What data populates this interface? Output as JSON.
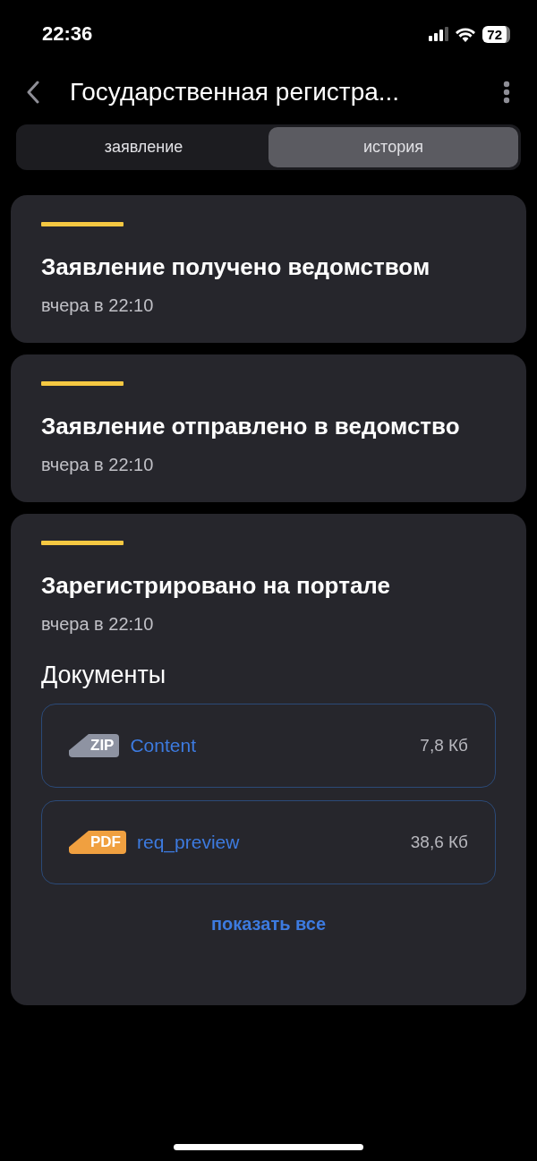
{
  "status_bar": {
    "time": "22:36",
    "battery": "72"
  },
  "header": {
    "title": "Государственная регистра..."
  },
  "tabs": [
    {
      "label": "заявление",
      "selected": false
    },
    {
      "label": "история",
      "selected": true
    }
  ],
  "events": [
    {
      "title": "Заявление получено ведомством",
      "time": "вчера в 22:10"
    },
    {
      "title": "Заявление отправлено в ведомство",
      "time": "вчера в 22:10"
    },
    {
      "title": "Зарегистрировано на портале",
      "time": "вчера в 22:10",
      "documents": {
        "heading": "Документы",
        "files": [
          {
            "kind": "zip",
            "badge": "ZIP",
            "name": "Content",
            "size": "7,8 Кб"
          },
          {
            "kind": "pdf",
            "badge": "PDF",
            "name": "req_preview",
            "size": "38,6 Кб"
          }
        ],
        "show_all": "показать все"
      }
    }
  ]
}
